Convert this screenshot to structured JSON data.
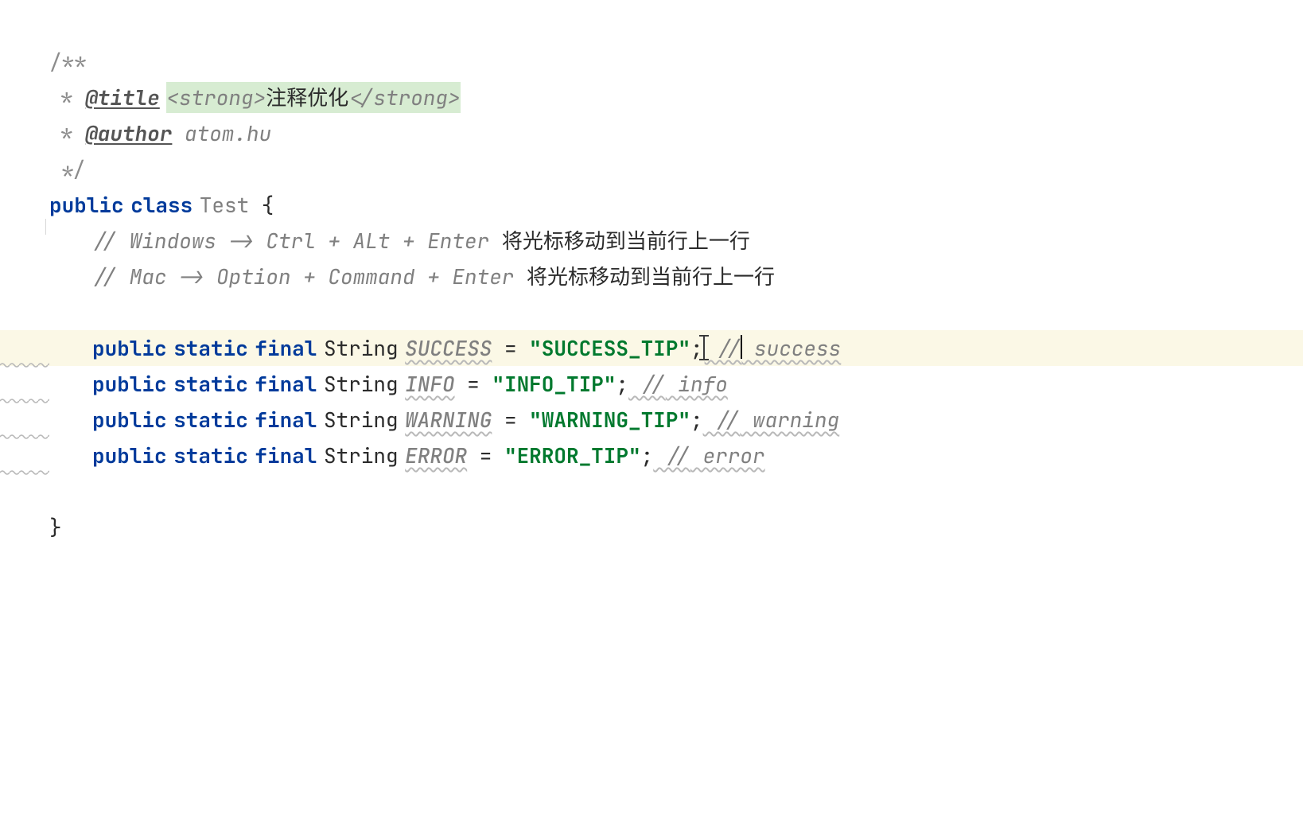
{
  "docComment": {
    "open": "/**",
    "titleStar": " * ",
    "titleTag": "@title",
    "titleTagOpen": "<strong>",
    "titleText": "注释优化",
    "titleTagClose": "</strong>",
    "authorStar": " * ",
    "authorTag": "@author",
    "authorName": " atom.hu",
    "close": " */"
  },
  "classDecl": {
    "kw1": "public",
    "kw2": "class",
    "name": "Test",
    "openBrace": " {",
    "closeBrace": "}"
  },
  "comments": {
    "win": "// Windows -> Ctrl + ALt + Enter ",
    "winCn": "将光标移动到当前行上一行",
    "mac": "// Mac -> Option + Command + Enter ",
    "macCn": "将光标移动到当前行上一行"
  },
  "tokens": {
    "kwPublic": "public",
    "kwStatic": "static",
    "kwFinal": "final",
    "typeString": "String",
    "eq": " = ",
    "semi": ";",
    "slash2": " //"
  },
  "fields": [
    {
      "name": "SUCCESS",
      "value": "\"SUCCESS_TIP\"",
      "comment": " success",
      "highlighted": true
    },
    {
      "name": "INFO",
      "value": "\"INFO_TIP\"",
      "comment": " info",
      "highlighted": false
    },
    {
      "name": "WARNING",
      "value": "\"WARNING_TIP\"",
      "comment": " warning",
      "highlighted": false
    },
    {
      "name": "ERROR",
      "value": "\"ERROR_TIP\"",
      "comment": " error",
      "highlighted": false
    }
  ]
}
